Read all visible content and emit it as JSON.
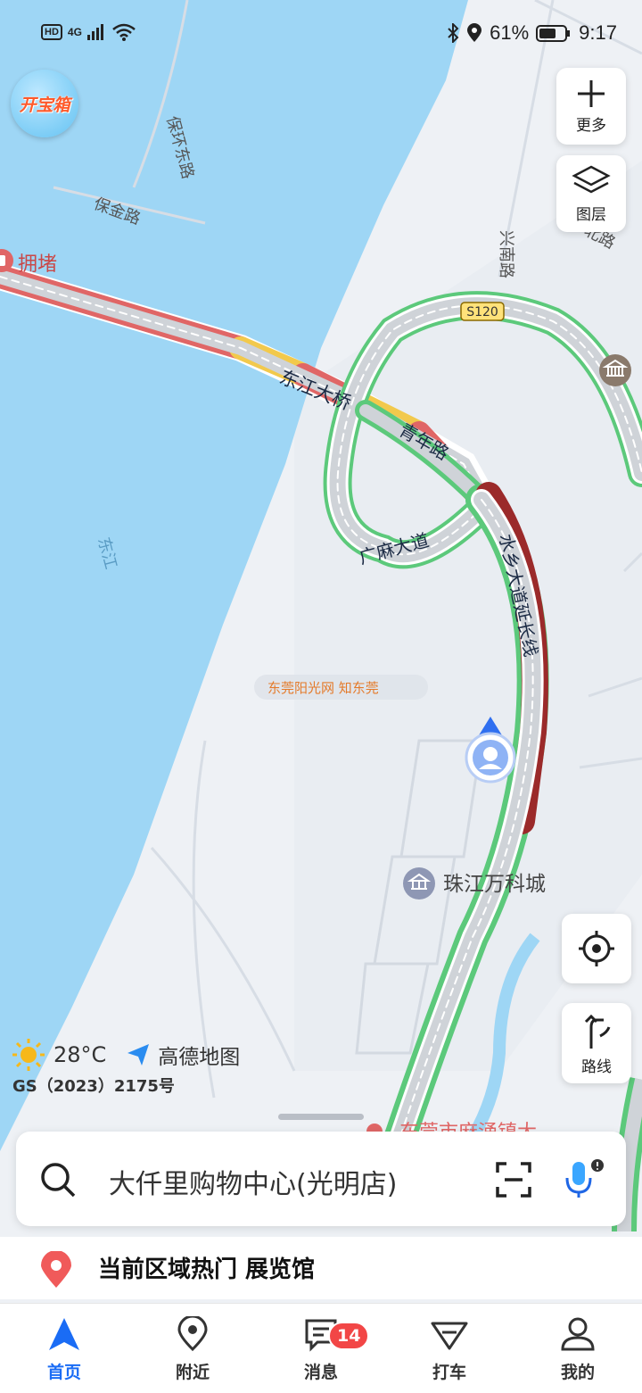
{
  "status_bar": {
    "hd": "HD",
    "network": "4G",
    "battery": "61%",
    "time": "9:17"
  },
  "treasure_label": "开宝箱",
  "controls": {
    "more_label": "更多",
    "layers_label": "图层",
    "route_label": "路线"
  },
  "map_labels": {
    "congestion": "拥堵",
    "baohuan_east": "保环东路",
    "baojin": "保金路",
    "xingnan": "兴南路",
    "road_partial": "北路",
    "highway": "S120",
    "dongjiang_bridge": "东江大桥",
    "qingnian": "青年路",
    "guangma": "广麻大道",
    "shuixiang": "水乡大道延长线",
    "river": "东江",
    "poi": "珠江万科城",
    "bottom_poi_partial": "东莞市麻涌镇大",
    "watermark": "东莞阳光网 知东莞"
  },
  "weather": {
    "temp": "28°C",
    "provider": "高德地图",
    "license": "GS（2023）2175号"
  },
  "search": {
    "query": "大仟里购物中心(光明店)"
  },
  "hot": {
    "text": "当前区域热门 展览馆"
  },
  "tabs": [
    {
      "label": "首页",
      "icon": "navigation-arrow-icon"
    },
    {
      "label": "附近",
      "icon": "location-pin-icon"
    },
    {
      "label": "消息",
      "icon": "message-icon",
      "badge": "14"
    },
    {
      "label": "打车",
      "icon": "taxi-icon"
    },
    {
      "label": "我的",
      "icon": "person-icon"
    }
  ],
  "colors": {
    "water": "#9ed6f5",
    "land": "#eef1f5",
    "congestion_red": "#e06666",
    "slow_yellow": "#f2c94c",
    "severe_dark": "#9b2a2a",
    "clear_green": "#5cc97b",
    "accent_blue": "#1a6cf5"
  }
}
